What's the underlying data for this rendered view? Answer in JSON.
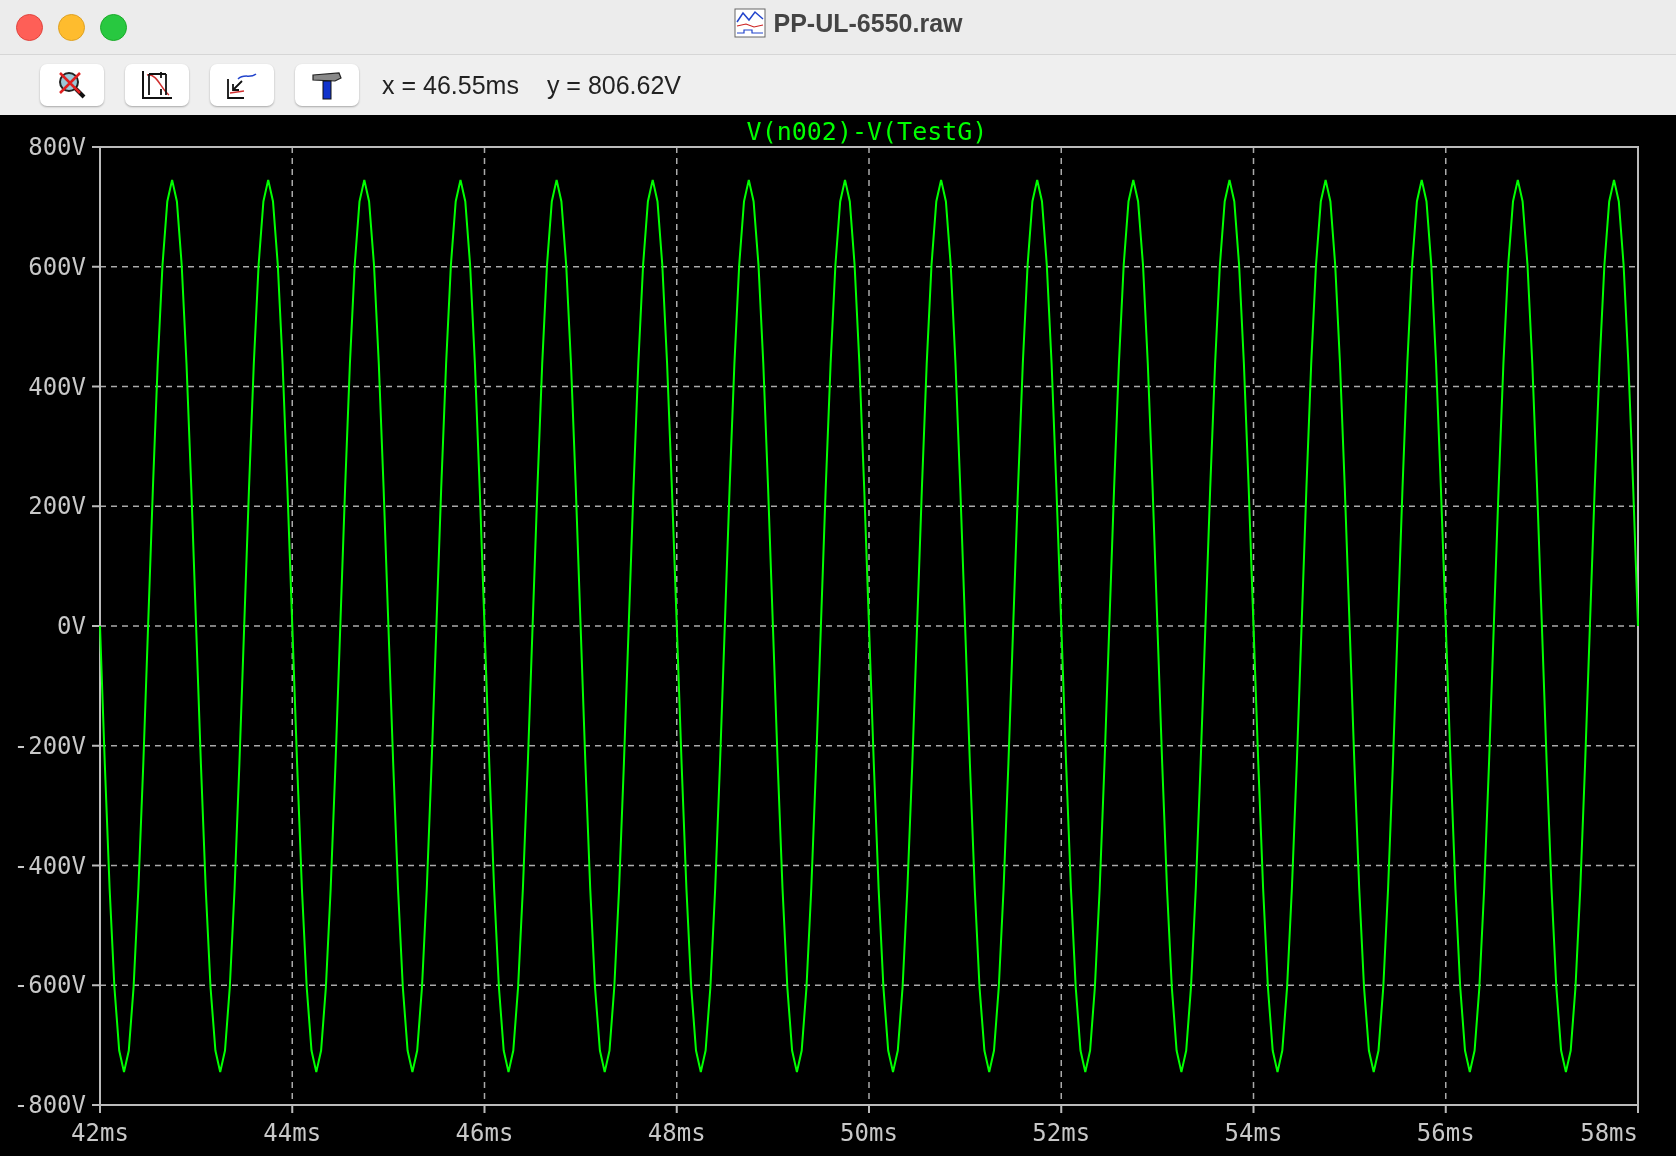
{
  "window": {
    "title": "PP-UL-6550.raw"
  },
  "toolbar": {
    "buttons": [
      {
        "kind": "autorange"
      },
      {
        "kind": "zoom-extents"
      },
      {
        "kind": "zoom-back"
      },
      {
        "kind": "tools"
      }
    ],
    "cursor_x": "x = 46.55ms",
    "cursor_y": "y = 806.62V"
  },
  "plot": {
    "chart_data": {
      "type": "line",
      "grid": true,
      "xlim": [
        42,
        58
      ],
      "ylim": [
        -800,
        800
      ],
      "xticks": [
        {
          "value": 42,
          "label": "42ms"
        },
        {
          "value": 44,
          "label": "44ms"
        },
        {
          "value": 46,
          "label": "46ms"
        },
        {
          "value": 48,
          "label": "48ms"
        },
        {
          "value": 50,
          "label": "50ms"
        },
        {
          "value": 52,
          "label": "52ms"
        },
        {
          "value": 54,
          "label": "54ms"
        },
        {
          "value": 56,
          "label": "56ms"
        },
        {
          "value": 58,
          "label": "58ms"
        }
      ],
      "yticks": [
        {
          "value": 800,
          "label": "800V"
        },
        {
          "value": 600,
          "label": "600V"
        },
        {
          "value": 400,
          "label": "400V"
        },
        {
          "value": 200,
          "label": "200V"
        },
        {
          "value": 0,
          "label": "0V"
        },
        {
          "value": -200,
          "label": "-200V"
        },
        {
          "value": -400,
          "label": "-400V"
        },
        {
          "value": -600,
          "label": "-600V"
        },
        {
          "value": -800,
          "label": "-800V"
        }
      ],
      "x": [
        42,
        42.05,
        42.1,
        42.15,
        42.2,
        42.25,
        42.3,
        42.35,
        42.4,
        42.45,
        42.5,
        42.55,
        42.6,
        42.65,
        42.7,
        42.75,
        42.8,
        42.85,
        42.9,
        42.95,
        43,
        43.05,
        43.1,
        43.15,
        43.2,
        43.25,
        43.3,
        43.35,
        43.4,
        43.45,
        43.5,
        43.55,
        43.6,
        43.65,
        43.7,
        43.75,
        43.8,
        43.85,
        43.9,
        43.95,
        44,
        44.05,
        44.1,
        44.15,
        44.2,
        44.25,
        44.3,
        44.35,
        44.4,
        44.45,
        44.5,
        44.55,
        44.6,
        44.65,
        44.7,
        44.75,
        44.8,
        44.85,
        44.9,
        44.95,
        45,
        45.05,
        45.1,
        45.15,
        45.2,
        45.25,
        45.3,
        45.35,
        45.4,
        45.45,
        45.5,
        45.55,
        45.6,
        45.65,
        45.7,
        45.75,
        45.8,
        45.85,
        45.9,
        45.95,
        46,
        46.05,
        46.1,
        46.15,
        46.2,
        46.25,
        46.3,
        46.35,
        46.4,
        46.45,
        46.5,
        46.55,
        46.6,
        46.65,
        46.7,
        46.75,
        46.8,
        46.85,
        46.9,
        46.95,
        47,
        47.05,
        47.1,
        47.15,
        47.2,
        47.25,
        47.3,
        47.35,
        47.4,
        47.45,
        47.5,
        47.55,
        47.6,
        47.65,
        47.7,
        47.75,
        47.8,
        47.85,
        47.9,
        47.95,
        48,
        48.05,
        48.1,
        48.15,
        48.2,
        48.25,
        48.3,
        48.35,
        48.4,
        48.45,
        48.5,
        48.55,
        48.6,
        48.65,
        48.7,
        48.75,
        48.8,
        48.85,
        48.9,
        48.95,
        49,
        49.05,
        49.1,
        49.15,
        49.2,
        49.25,
        49.3,
        49.35,
        49.4,
        49.45,
        49.5,
        49.55,
        49.6,
        49.65,
        49.7,
        49.75,
        49.8,
        49.85,
        49.9,
        49.95,
        50,
        50.05,
        50.1,
        50.15,
        50.2,
        50.25,
        50.3,
        50.35,
        50.4,
        50.45,
        50.5,
        50.55,
        50.6,
        50.65,
        50.7,
        50.75,
        50.8,
        50.85,
        50.9,
        50.95,
        51,
        51.05,
        51.1,
        51.15,
        51.2,
        51.25,
        51.3,
        51.35,
        51.4,
        51.45,
        51.5,
        51.55,
        51.6,
        51.65,
        51.7,
        51.75,
        51.8,
        51.85,
        51.9,
        51.95,
        52,
        52.05,
        52.1,
        52.15,
        52.2,
        52.25,
        52.3,
        52.35,
        52.4,
        52.45,
        52.5,
        52.55,
        52.6,
        52.65,
        52.7,
        52.75,
        52.8,
        52.85,
        52.9,
        52.95,
        53,
        53.05,
        53.1,
        53.15,
        53.2,
        53.25,
        53.3,
        53.35,
        53.4,
        53.45,
        53.5,
        53.55,
        53.6,
        53.65,
        53.7,
        53.75,
        53.8,
        53.85,
        53.9,
        53.95,
        54,
        54.05,
        54.1,
        54.15,
        54.2,
        54.25,
        54.3,
        54.35,
        54.4,
        54.45,
        54.5,
        54.55,
        54.6,
        54.65,
        54.7,
        54.75,
        54.8,
        54.85,
        54.9,
        54.95,
        55,
        55.05,
        55.1,
        55.15,
        55.2,
        55.25,
        55.3,
        55.35,
        55.4,
        55.45,
        55.5,
        55.55,
        55.6,
        55.65,
        55.7,
        55.75,
        55.8,
        55.85,
        55.9,
        55.95,
        56,
        56.05,
        56.1,
        56.15,
        56.2,
        56.25,
        56.3,
        56.35,
        56.4,
        56.45,
        56.5,
        56.55,
        56.6,
        56.65,
        56.7,
        56.75,
        56.8,
        56.85,
        56.9,
        56.95,
        57,
        57.05,
        57.1,
        57.15,
        57.2,
        57.25,
        57.3,
        57.35,
        57.4,
        57.45,
        57.5,
        57.55,
        57.6,
        57.65,
        57.7,
        57.75,
        57.8,
        57.85,
        57.9,
        57.95,
        58
      ],
      "series": [
        {
          "name": "V(n002)-V(TestG)",
          "color": "#00ff00",
          "values": [
            0,
            -230,
            -438,
            -603,
            -709,
            -745,
            -709,
            -603,
            -438,
            -230,
            0,
            230,
            438,
            603,
            709,
            745,
            709,
            603,
            438,
            230,
            0,
            -230,
            -438,
            -603,
            -709,
            -745,
            -709,
            -603,
            -438,
            -230,
            0,
            230,
            438,
            603,
            709,
            745,
            709,
            603,
            438,
            230,
            0,
            -230,
            -438,
            -603,
            -709,
            -745,
            -709,
            -603,
            -438,
            -230,
            0,
            230,
            438,
            603,
            709,
            745,
            709,
            603,
            438,
            230,
            0,
            -230,
            -438,
            -603,
            -709,
            -745,
            -709,
            -603,
            -438,
            -230,
            0,
            230,
            438,
            603,
            709,
            745,
            709,
            603,
            438,
            230,
            0,
            -230,
            -438,
            -603,
            -709,
            -745,
            -709,
            -603,
            -438,
            -230,
            0,
            230,
            438,
            603,
            709,
            745,
            709,
            603,
            438,
            230,
            0,
            -230,
            -438,
            -603,
            -709,
            -745,
            -709,
            -603,
            -438,
            -230,
            0,
            230,
            438,
            603,
            709,
            745,
            709,
            603,
            438,
            230,
            0,
            -230,
            -438,
            -603,
            -709,
            -745,
            -709,
            -603,
            -438,
            -230,
            0,
            230,
            438,
            603,
            709,
            745,
            709,
            603,
            438,
            230,
            0,
            -230,
            -438,
            -603,
            -709,
            -745,
            -709,
            -603,
            -438,
            -230,
            0,
            230,
            438,
            603,
            709,
            745,
            709,
            603,
            438,
            230,
            0,
            -230,
            -438,
            -603,
            -709,
            -745,
            -709,
            -603,
            -438,
            -230,
            0,
            230,
            438,
            603,
            709,
            745,
            709,
            603,
            438,
            230,
            0,
            -230,
            -438,
            -603,
            -709,
            -745,
            -709,
            -603,
            -438,
            -230,
            0,
            230,
            438,
            603,
            709,
            745,
            709,
            603,
            438,
            230,
            0,
            -230,
            -438,
            -603,
            -709,
            -745,
            -709,
            -603,
            -438,
            -230,
            0,
            230,
            438,
            603,
            709,
            745,
            709,
            603,
            438,
            230,
            0,
            -230,
            -438,
            -603,
            -709,
            -745,
            -709,
            -603,
            -438,
            -230,
            0,
            230,
            438,
            603,
            709,
            745,
            709,
            603,
            438,
            230,
            0,
            -230,
            -438,
            -603,
            -709,
            -745,
            -709,
            -603,
            -438,
            -230,
            0,
            230,
            438,
            603,
            709,
            745,
            709,
            603,
            438,
            230,
            0,
            -230,
            -438,
            -603,
            -709,
            -745,
            -709,
            -603,
            -438,
            -230,
            0,
            230,
            438,
            603,
            709,
            745,
            709,
            603,
            438,
            230,
            0,
            -230,
            -438,
            -603,
            -709,
            -745,
            -709,
            -603,
            -438,
            -230,
            0,
            230,
            438,
            603,
            709,
            745,
            709,
            603,
            438,
            230,
            0,
            -230,
            -438,
            -603,
            -709,
            -745,
            -709,
            -603,
            -438,
            -230,
            0,
            230,
            438,
            603,
            709,
            745,
            709,
            603,
            438,
            230,
            0
          ]
        }
      ]
    }
  }
}
